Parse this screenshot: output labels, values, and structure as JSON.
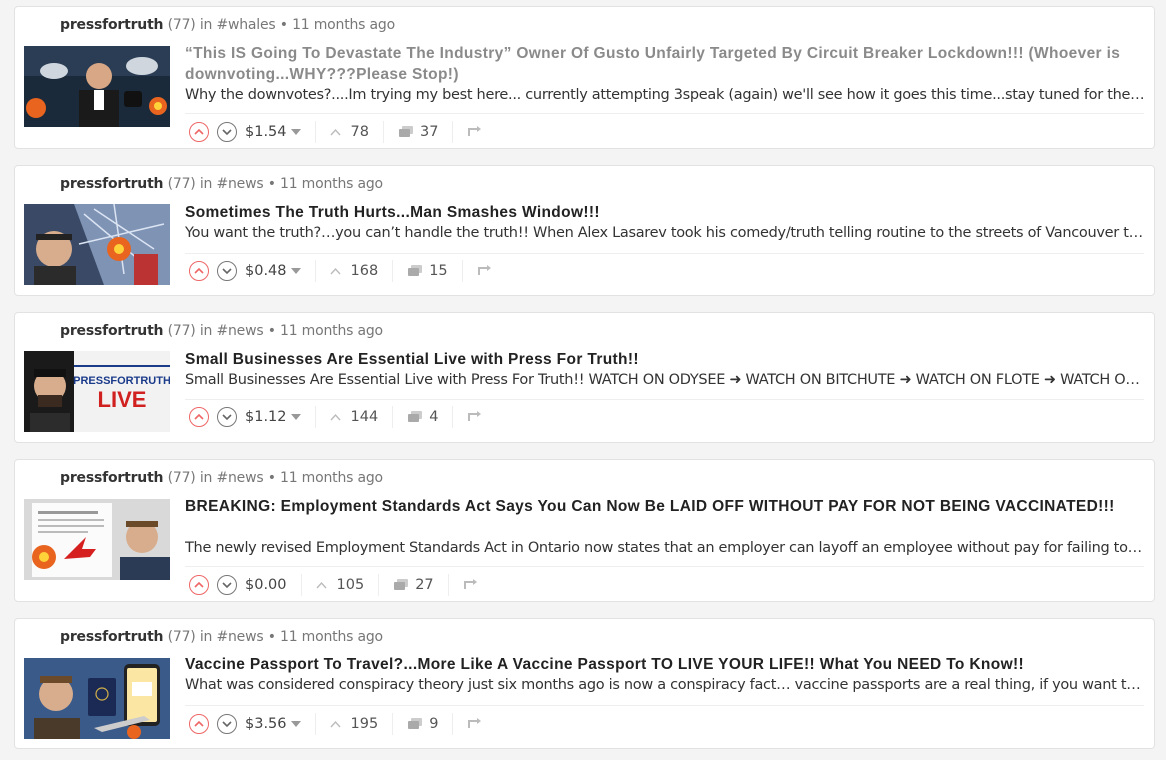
{
  "posts": [
    {
      "author": "pressfortruth",
      "reputation": "(77)",
      "in_label": "in",
      "tag": "#whales",
      "dot": "•",
      "time": "11 months ago",
      "title": "“This IS Going To Devastate The Industry” Owner Of Gusto Unfairly Targeted By Circuit Breaker Lockdown!!! (Whoever is downvoting...WHY???Please Stop!)",
      "title_visited": true,
      "description": "Why the downvotes?....Im trying my best here... currently attempting 3speak (again) we'll see how it goes this time...stay tuned for the vid!! To …",
      "payout": "$1.54",
      "votes": "78",
      "comments": "37",
      "thumb": "press-conference"
    },
    {
      "author": "pressfortruth",
      "reputation": "(77)",
      "in_label": "in",
      "tag": "#news",
      "dot": "•",
      "time": "11 months ago",
      "title": "Sometimes The Truth Hurts...Man Smashes Window!!!",
      "title_visited": false,
      "description": "You want the truth?…you can’t handle the truth!! When Alex Lasarev took his comedy/truth telling routine to the streets of Vancouver there w…",
      "payout": "$0.48",
      "votes": "168",
      "comments": "15",
      "thumb": "window-smash"
    },
    {
      "author": "pressfortruth",
      "reputation": "(77)",
      "in_label": "in",
      "tag": "#news",
      "dot": "•",
      "time": "11 months ago",
      "title": "Small Businesses Are Essential Live with Press For Truth!!",
      "title_visited": false,
      "description": "Small Businesses Are Essential Live with Press For Truth!! WATCH ON ODYSEE ➜ WATCH ON BITCHUTE ➜ WATCH ON FLOTE ➜ WATCH ON MIN…",
      "payout": "$1.12",
      "votes": "144",
      "comments": "4",
      "thumb": "pft-live",
      "thumb_text_top": "PRESSFORTRUTH",
      "thumb_text_bottom": "LIVE"
    },
    {
      "author": "pressfortruth",
      "reputation": "(77)",
      "in_label": "in",
      "tag": "#news",
      "dot": "•",
      "time": "11 months ago",
      "title": "BREAKING: Employment Standards Act Says You Can Now Be LAID OFF WITHOUT PAY FOR NOT BEING VACCINATED!!!",
      "title_visited": false,
      "description": "The newly revised Employment Standards Act in Ontario now states that an employer can layoff an employee without pay for failing to prove t…",
      "payout": "$0.00",
      "votes": "105",
      "comments": "27",
      "thumb": "document-fire"
    },
    {
      "author": "pressfortruth",
      "reputation": "(77)",
      "in_label": "in",
      "tag": "#news",
      "dot": "•",
      "time": "11 months ago",
      "title": "Vaccine Passport To Travel?...More Like A Vaccine Passport TO LIVE YOUR LIFE!! What You NEED To Know!!",
      "title_visited": false,
      "description": "What was considered conspiracy theory just six months ago is now a conspiracy fact… vaccine passports are a real thing, if you want to travel …",
      "payout": "$3.56",
      "votes": "195",
      "comments": "9",
      "thumb": "passport"
    }
  ],
  "colors": {
    "upvote": "#e66666",
    "downvote": "#777777",
    "visited_title": "#8a8a8a"
  }
}
